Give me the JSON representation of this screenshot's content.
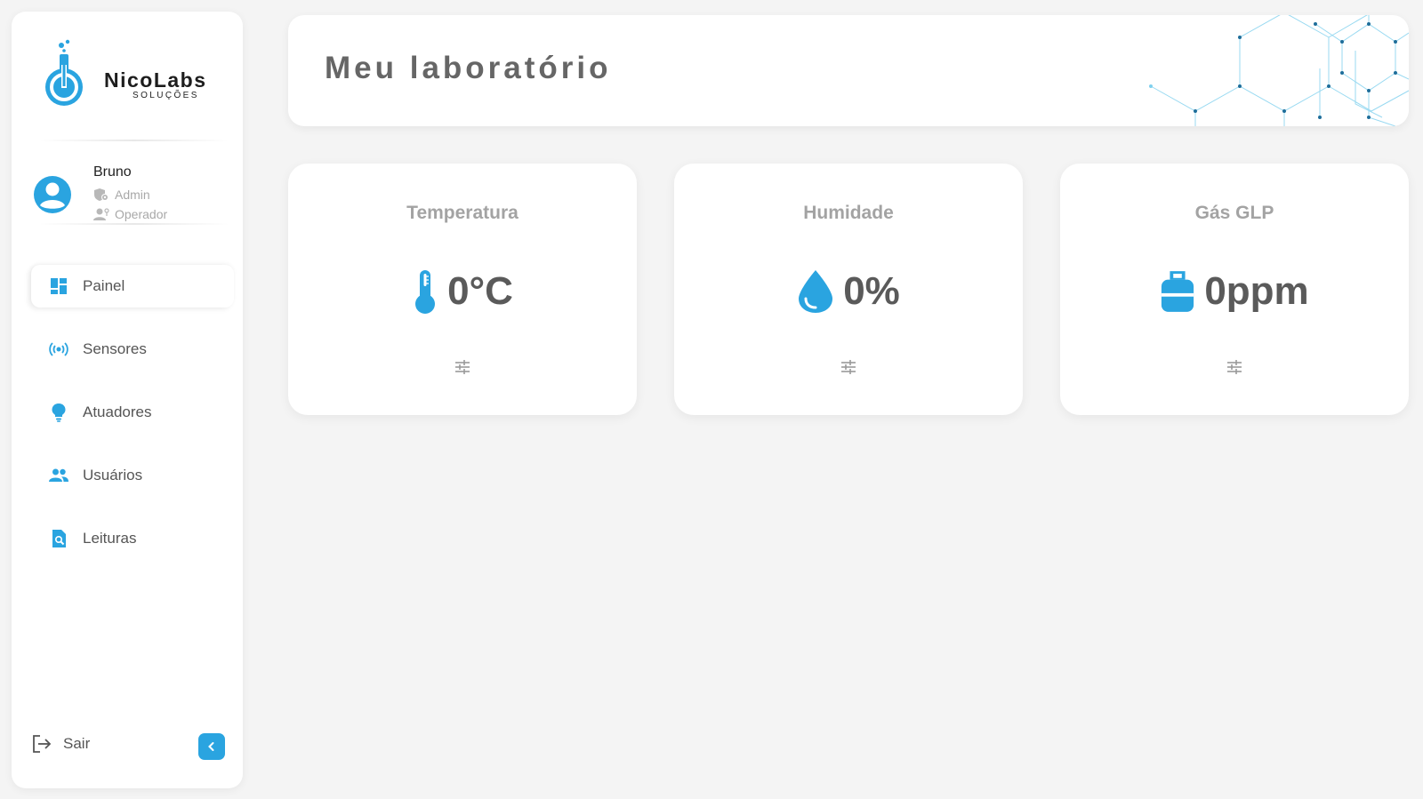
{
  "brand": {
    "name": "NicoLabs",
    "sub": "SOLUÇÕES",
    "accent": "#2aa4e0"
  },
  "user": {
    "name": "Bruno",
    "roles": [
      "Admin",
      "Operador"
    ]
  },
  "nav": [
    {
      "label": "Painel",
      "icon": "dashboard-icon",
      "active": true
    },
    {
      "label": "Sensores",
      "icon": "sensor-icon"
    },
    {
      "label": "Atuadores",
      "icon": "lightbulb-icon"
    },
    {
      "label": "Usuários",
      "icon": "users-icon"
    },
    {
      "label": "Leituras",
      "icon": "file-search-icon"
    }
  ],
  "logout": {
    "label": "Sair",
    "icon": "logout-icon"
  },
  "header": {
    "title": "Meu laboratório"
  },
  "cards": [
    {
      "title": "Temperatura",
      "value": "0°C",
      "icon": "thermometer-icon"
    },
    {
      "title": "Humidade",
      "value": "0%",
      "icon": "water-drop-icon"
    },
    {
      "title": "Gás GLP",
      "value": "0ppm",
      "icon": "gas-cylinder-icon"
    }
  ]
}
